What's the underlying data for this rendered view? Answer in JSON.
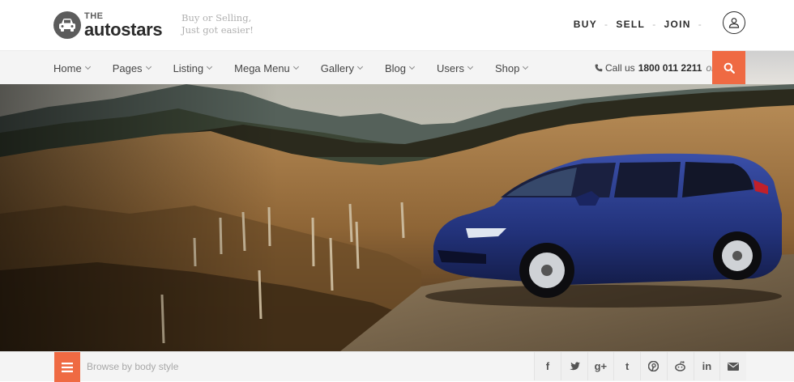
{
  "header": {
    "logo_the": "THE",
    "logo_name": "autostars",
    "tagline_line1": "Buy or Selling,",
    "tagline_line2": "Just got easier!",
    "auth": [
      "BUY",
      "SELL",
      "JOIN"
    ],
    "auth_separator": "-"
  },
  "nav": {
    "items": [
      "Home",
      "Pages",
      "Listing",
      "Mega Menu",
      "Gallery",
      "Blog",
      "Users",
      "Shop"
    ],
    "call_label": "Call us",
    "call_number": "1800 011 2211",
    "call_or": "or"
  },
  "bottom": {
    "browse_placeholder": "Browse by body style",
    "social_glyphs": [
      "f",
      "t",
      "g+",
      "t",
      "p",
      "r",
      "in",
      "✉"
    ],
    "social_icons": [
      "facebook-icon",
      "twitter-icon",
      "google-plus-icon",
      "tumblr-icon",
      "pinterest-icon",
      "reddit-icon",
      "linkedin-icon",
      "email-icon"
    ]
  },
  "colors": {
    "accent": "#ef6a43",
    "text_dark": "#2b2b2b",
    "nav_bg": "#f4f4f4"
  }
}
